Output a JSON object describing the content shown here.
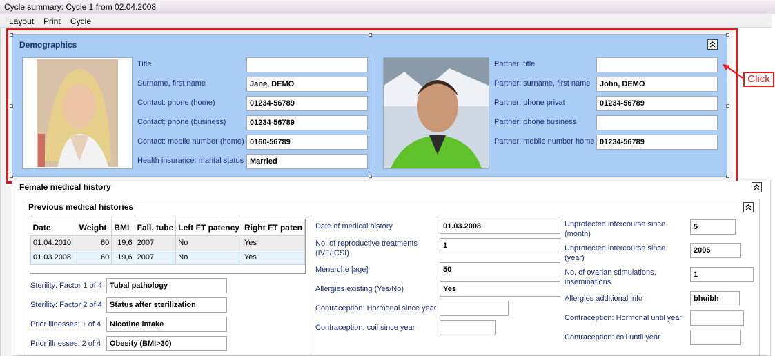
{
  "window": {
    "title": "Cycle summary: Cycle 1 from 02.04.2008"
  },
  "menu": [
    "Layout",
    "Print",
    "Cycle"
  ],
  "callout": {
    "label": "Click"
  },
  "demographics": {
    "title": "Demographics",
    "collapse_glyph": "⌃",
    "left_fields": [
      {
        "label": "Title",
        "value": ""
      },
      {
        "label": "Surname, first name",
        "value": "Jane, DEMO"
      },
      {
        "label": "Contact: phone (home)",
        "value": "01234-56789"
      },
      {
        "label": "Contact: phone (business)",
        "value": "01234-56789"
      },
      {
        "label": "Contact: mobile number (home)",
        "value": "0160-56789"
      },
      {
        "label": "Health insurance: marital status",
        "value": "Married"
      }
    ],
    "right_fields": [
      {
        "label": "Partner: title",
        "value": ""
      },
      {
        "label": "Partner: surname, first name",
        "value": "John, DEMO"
      },
      {
        "label": "Partner: phone privat",
        "value": "01234-56789"
      },
      {
        "label": "Partner: phone business",
        "value": ""
      },
      {
        "label": "Partner: mobile number home",
        "value": "01234-56789"
      }
    ]
  },
  "female_history": {
    "title": "Female medical history"
  },
  "previous_histories": {
    "title": "Previous medical histories",
    "table": {
      "columns": [
        "Date",
        "Weight",
        "BMI",
        "Fall. tube",
        "Left FT patency",
        "Right FT paten"
      ],
      "rows": [
        [
          "01.04.2010",
          "60",
          "19,6",
          "2007",
          "No",
          "Yes"
        ],
        [
          "01.03.2008",
          "60",
          "19,6",
          "2007",
          "No",
          "Yes"
        ]
      ]
    },
    "factors": [
      {
        "label": "Sterility: Factor 1 of 4",
        "value": "Tubal pathology"
      },
      {
        "label": "Sterility: Factor 2 of 4",
        "value": "Status after sterilization"
      },
      {
        "label": "Prior illnesses: 1 of 4",
        "value": "Nicotine intake"
      },
      {
        "label": "Prior illnesses: 2 of 4",
        "value": "Obesity (BMI>30)"
      }
    ],
    "middle": [
      {
        "label": "Date of medical history",
        "value": "01.03.2008"
      },
      {
        "label": "No. of reproductive treatments (IVF/ICSI)",
        "value": "1"
      },
      {
        "label": "Menarche [age]",
        "value": "50"
      },
      {
        "label": "Allergies existing (Yes/No)",
        "value": "Yes"
      },
      {
        "label": "Contraception: Hormonal since year",
        "value": ""
      },
      {
        "label": "Contraception: coil since year",
        "value": ""
      }
    ],
    "right": [
      {
        "label": "Unprotected intercourse since (month)",
        "value": "5"
      },
      {
        "label": "Unprotected intercourse since (year)",
        "value": "2006"
      },
      {
        "label": "No. of ovarian stimulations, inseminations",
        "value": "1"
      },
      {
        "label": "Allergies additional info",
        "value": "bhuibh"
      },
      {
        "label": "Contraception: Hormonal until year",
        "value": ""
      },
      {
        "label": "Contraception: coil until year",
        "value": ""
      }
    ]
  }
}
